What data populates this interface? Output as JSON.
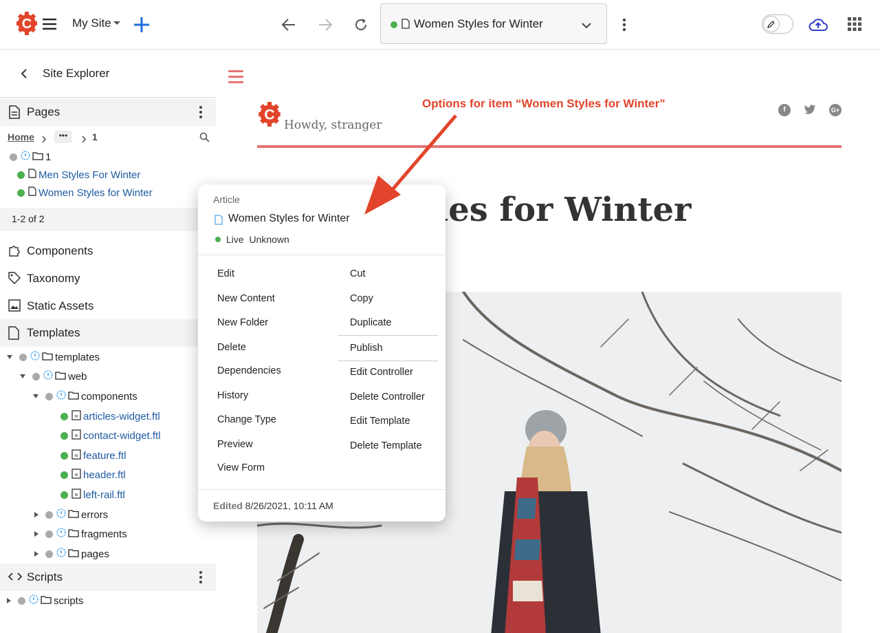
{
  "topbar": {
    "site_name": "My Site",
    "address_title": "Women Styles for Winter",
    "icons": [
      "crafter-logo-icon",
      "menu-icon",
      "add-icon",
      "back-icon",
      "forward-icon",
      "refresh-icon",
      "page-icon",
      "chevron-down-icon",
      "kebab-icon",
      "edit-toggle-icon",
      "publish-cloud-icon",
      "apps-grid-icon"
    ]
  },
  "sidebar": {
    "title": "Site Explorer",
    "pages": {
      "label": "Pages",
      "breadcrumb": {
        "home": "Home",
        "ellipsis": "•••",
        "current": "1"
      },
      "folder": "1",
      "items": [
        "Men Styles For Winter",
        "Women Styles for Winter"
      ],
      "pagination": "1-2 of 2"
    },
    "sections": {
      "components": "Components",
      "taxonomy": "Taxonomy",
      "static_assets": "Static Assets",
      "templates": "Templates",
      "scripts": "Scripts"
    },
    "templates_tree": {
      "root": "templates",
      "web": "web",
      "components": "components",
      "files": [
        "articles-widget.ftl",
        "contact-widget.ftl",
        "feature.ftl",
        "header.ftl",
        "left-rail.ftl"
      ],
      "errors": "errors",
      "fragments": "fragments",
      "pages": "pages"
    },
    "scripts_tree": {
      "root": "scripts"
    }
  },
  "preview": {
    "greeting": "Howdy, stranger",
    "annotation": "Options for item “Women Styles for Winter”",
    "heading_fragment": "les for Winter",
    "accent_color": "#e57373",
    "annotation_color": "#e2452b"
  },
  "menu": {
    "type_label": "Article",
    "item_name": "Women Styles for Winter",
    "status_live": "Live",
    "status_other": "Unknown",
    "left": [
      "Edit",
      "New Content",
      "New Folder",
      "Delete",
      "Dependencies",
      "History",
      "Change Type",
      "Preview",
      "View Form"
    ],
    "right": [
      "Cut",
      "Copy",
      "Duplicate",
      "Publish",
      "Edit Controller",
      "Delete Controller",
      "Edit Template",
      "Delete Template"
    ],
    "edited_label": "Edited",
    "edited_date": "8/26/2021, 10:11 AM"
  }
}
